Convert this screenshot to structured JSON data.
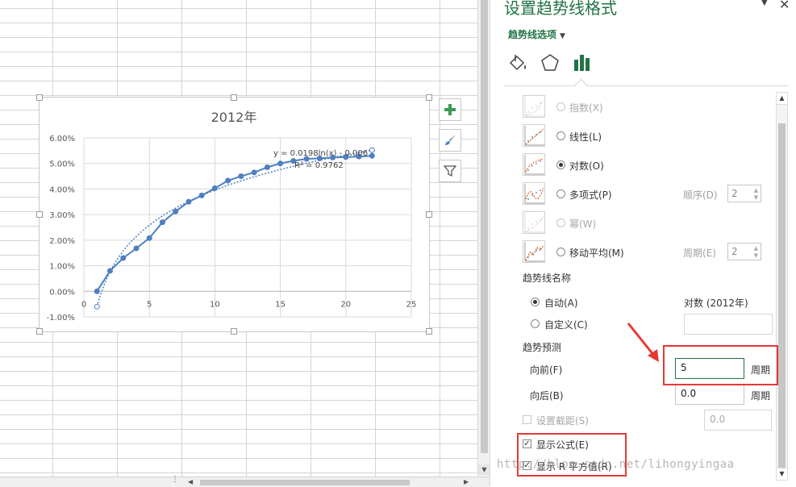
{
  "chart_data": {
    "type": "line",
    "title": "2012年",
    "x": [
      1,
      2,
      3,
      4,
      5,
      6,
      7,
      8,
      9,
      10,
      11,
      12,
      13,
      14,
      15,
      16,
      17,
      18,
      19,
      20,
      21,
      22
    ],
    "series": [
      {
        "values": [
          0.0,
          0.008,
          0.013,
          0.0168,
          0.0208,
          0.027,
          0.0312,
          0.035,
          0.0375,
          0.0403,
          0.0433,
          0.045,
          0.0465,
          0.0485,
          0.05,
          0.051,
          0.0518,
          0.052,
          0.0523,
          0.0525,
          0.0527,
          0.053
        ],
        "color": "#4e7fc0"
      }
    ],
    "trendline": {
      "type": "logarithmic",
      "a": 0.0198,
      "b": -0.006,
      "forward": 5,
      "color": "#4e7fc0"
    },
    "equation_label": "y = 0.0198ln(x) - 0.006",
    "r2_label": "R² = 0.9762",
    "ylim": [
      -0.01,
      0.06
    ],
    "xlim": [
      0,
      25
    ],
    "y_ticks": [
      "6.00%",
      "5.00%",
      "4.00%",
      "3.00%",
      "2.00%",
      "1.00%",
      "0.00%",
      "-1.00%"
    ],
    "x_ticks": [
      "0",
      "5",
      "10",
      "15",
      "20",
      "25"
    ],
    "grid": true
  },
  "pane": {
    "title": "设置趋势线格式",
    "options_label": "趋势线选项",
    "trend_types": [
      {
        "label": "指数(X)",
        "disabled": true,
        "selected": false
      },
      {
        "label": "线性(L)",
        "disabled": false,
        "selected": false
      },
      {
        "label": "对数(O)",
        "disabled": false,
        "selected": true
      },
      {
        "label": "多项式(P)",
        "disabled": false,
        "selected": false
      },
      {
        "label": "幂(W)",
        "disabled": true,
        "selected": false
      },
      {
        "label": "移动平均(M)",
        "disabled": false,
        "selected": false
      }
    ],
    "order_label": "顺序(D)",
    "order_value": "2",
    "period_label": "周期(E)",
    "period_value": "2",
    "name_section": "趋势线名称",
    "auto_label": "自动(A)",
    "auto_value": "对数 (2012年)",
    "custom_label": "自定义(C)",
    "forecast_section": "趋势预测",
    "forward_label": "向前(F)",
    "forward_value": "5",
    "forward_unit": "周期",
    "backward_label": "向后(B)",
    "backward_value": "0.0",
    "backward_unit": "周期",
    "intercept_label": "设置截距(S)",
    "intercept_value": "0.0",
    "show_equation_label": "显示公式(E)",
    "show_equation": true,
    "show_r2_label": "显示 R 平方值(R)",
    "show_r2": true
  },
  "watermark": "http://blog.csdn.net/lihongyingaa"
}
